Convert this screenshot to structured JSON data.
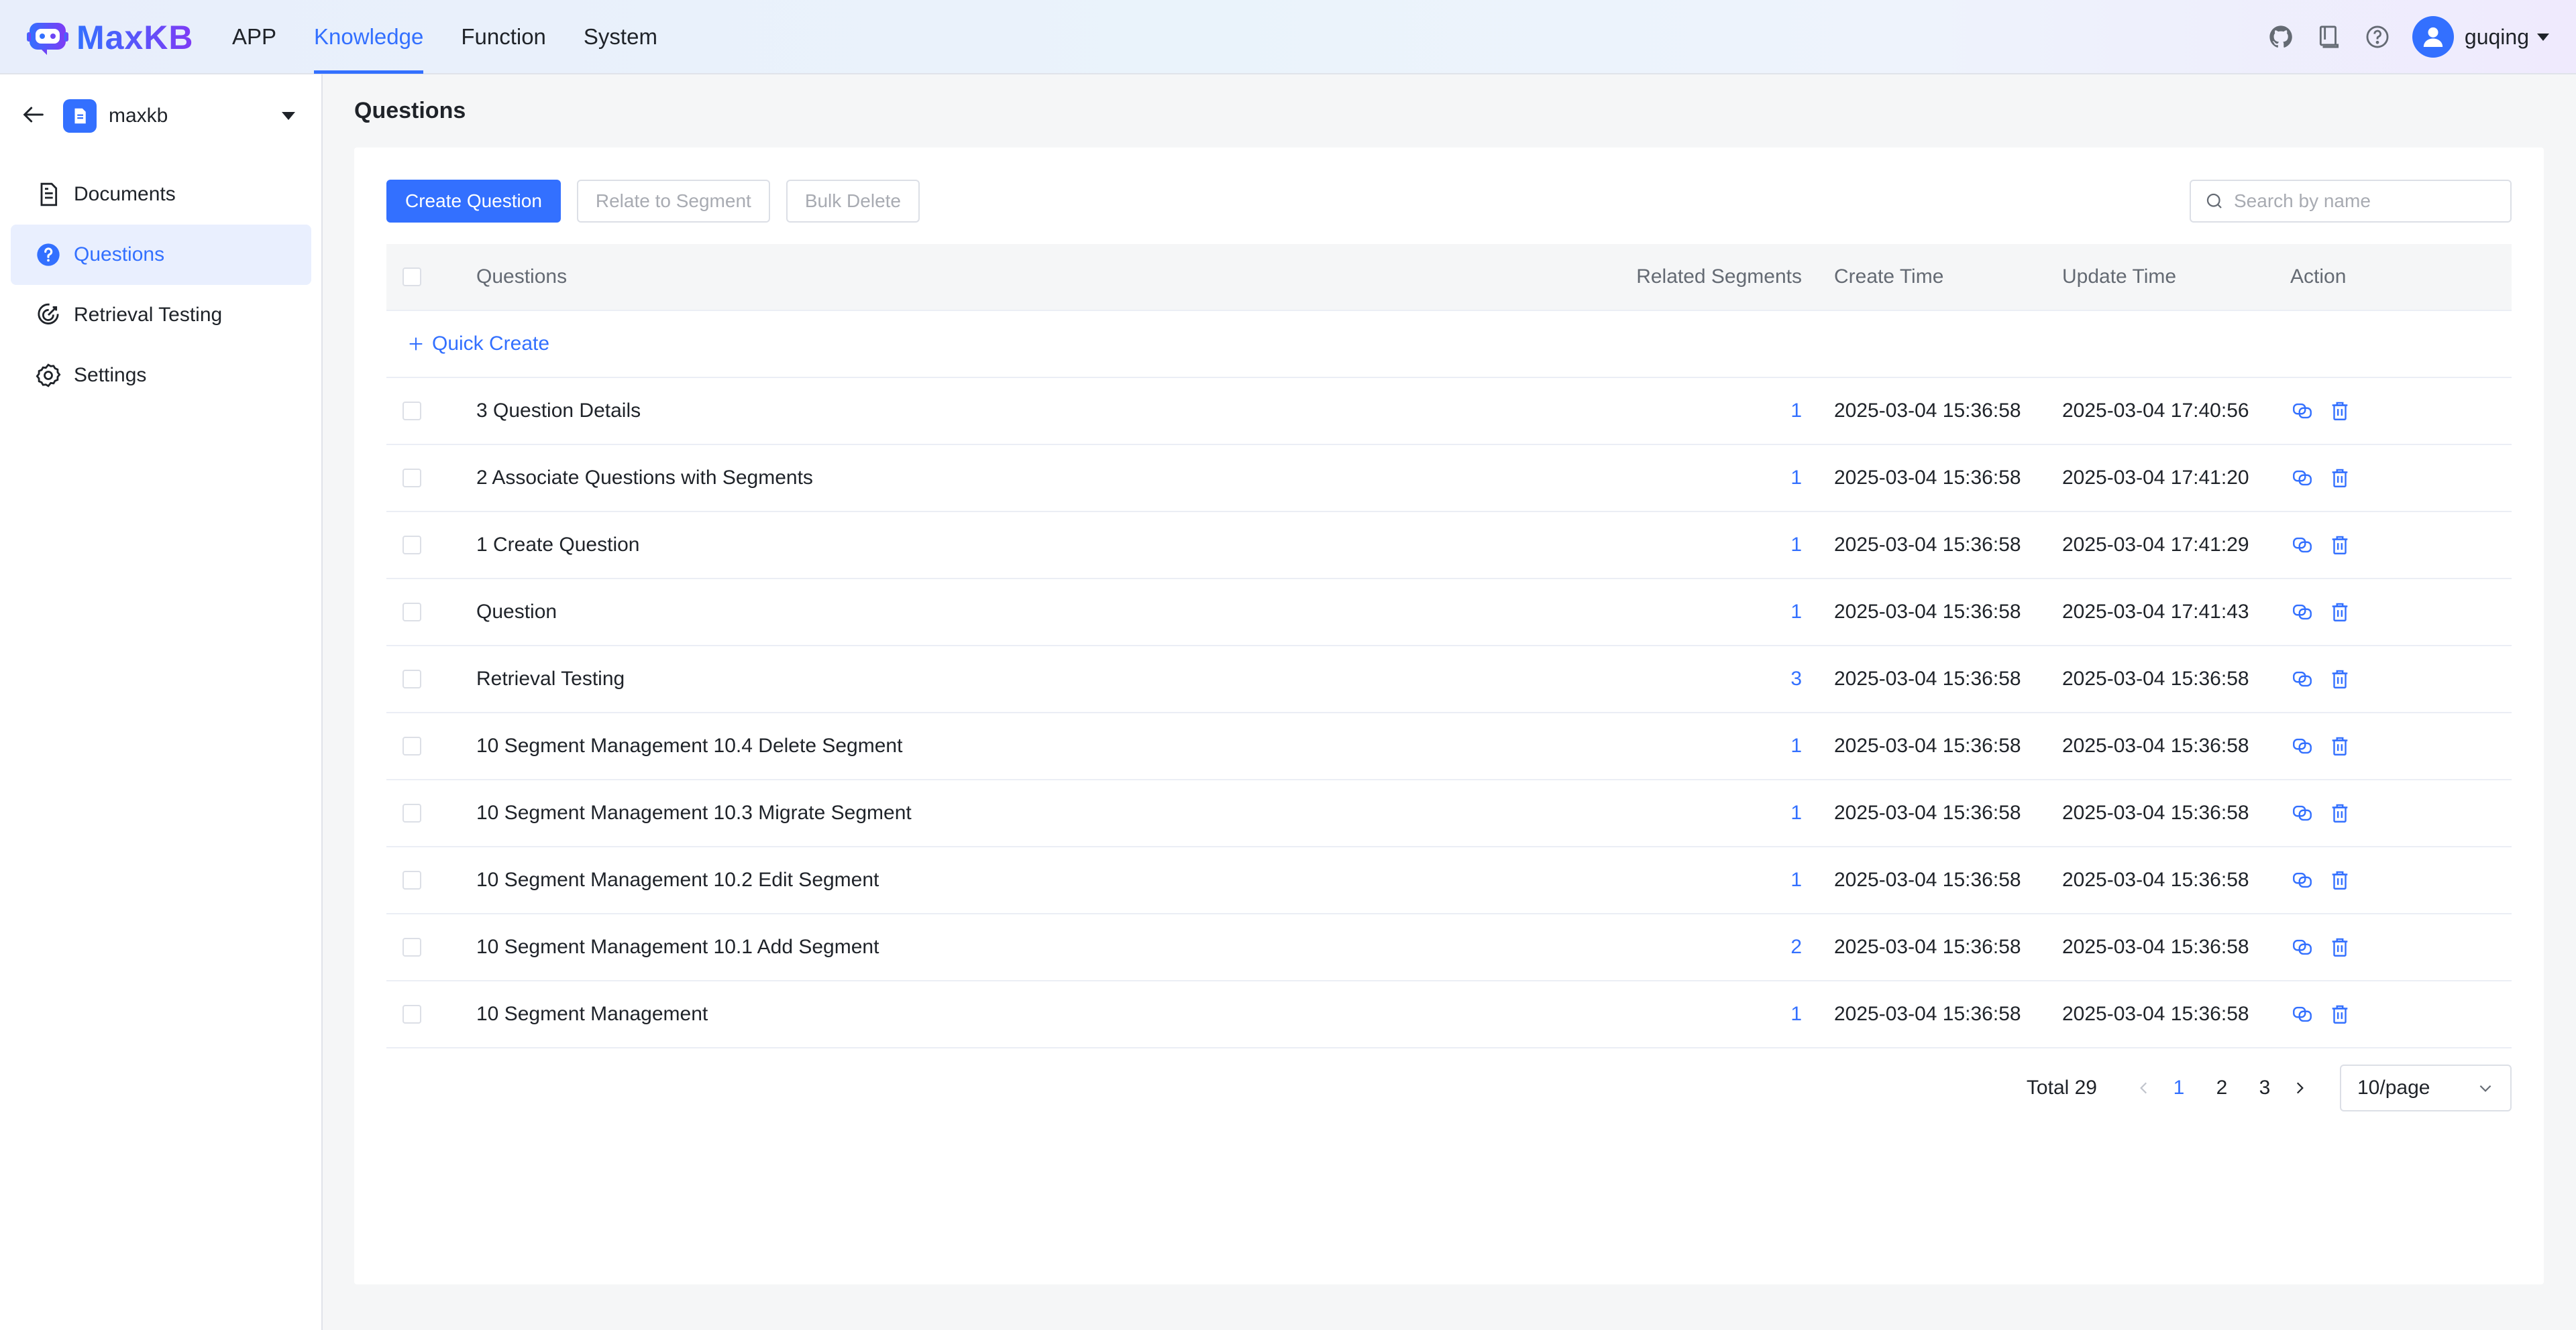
{
  "header": {
    "brand": "MaxKB",
    "nav": [
      "APP",
      "Knowledge",
      "Function",
      "System"
    ],
    "active_nav": "Knowledge",
    "icons": [
      "github-icon",
      "book-icon",
      "help-icon"
    ],
    "username": "guqing"
  },
  "sidebar": {
    "knowledge_base": "maxkb",
    "items": [
      {
        "label": "Documents",
        "icon": "document-icon"
      },
      {
        "label": "Questions",
        "icon": "question-icon",
        "active": true
      },
      {
        "label": "Retrieval Testing",
        "icon": "target-icon"
      },
      {
        "label": "Settings",
        "icon": "gear-icon"
      }
    ]
  },
  "page": {
    "title": "Questions"
  },
  "toolbar": {
    "create_label": "Create Question",
    "relate_label": "Relate to Segment",
    "bulk_delete_label": "Bulk Delete",
    "search_placeholder": "Search by name"
  },
  "table": {
    "columns": [
      "Questions",
      "Related Segments",
      "Create Time",
      "Update Time",
      "Action"
    ],
    "quick_create": "Quick Create",
    "rows": [
      {
        "question": "3 Question Details",
        "segments": "1",
        "create_time": "2025-03-04 15:36:58",
        "update_time": "2025-03-04 17:40:56"
      },
      {
        "question": "2 Associate Questions with Segments",
        "segments": "1",
        "create_time": "2025-03-04 15:36:58",
        "update_time": "2025-03-04 17:41:20"
      },
      {
        "question": "1 Create Question",
        "segments": "1",
        "create_time": "2025-03-04 15:36:58",
        "update_time": "2025-03-04 17:41:29"
      },
      {
        "question": "Question",
        "segments": "1",
        "create_time": "2025-03-04 15:36:58",
        "update_time": "2025-03-04 17:41:43"
      },
      {
        "question": "Retrieval Testing",
        "segments": "3",
        "create_time": "2025-03-04 15:36:58",
        "update_time": "2025-03-04 15:36:58"
      },
      {
        "question": "10 Segment Management 10.4 Delete Segment",
        "segments": "1",
        "create_time": "2025-03-04 15:36:58",
        "update_time": "2025-03-04 15:36:58"
      },
      {
        "question": "10 Segment Management 10.3 Migrate Segment",
        "segments": "1",
        "create_time": "2025-03-04 15:36:58",
        "update_time": "2025-03-04 15:36:58"
      },
      {
        "question": "10 Segment Management 10.2 Edit Segment",
        "segments": "1",
        "create_time": "2025-03-04 15:36:58",
        "update_time": "2025-03-04 15:36:58"
      },
      {
        "question": "10 Segment Management 10.1 Add Segment",
        "segments": "2",
        "create_time": "2025-03-04 15:36:58",
        "update_time": "2025-03-04 15:36:58"
      },
      {
        "question": "10 Segment Management",
        "segments": "1",
        "create_time": "2025-03-04 15:36:58",
        "update_time": "2025-03-04 15:36:58"
      }
    ]
  },
  "pagination": {
    "total": "Total 29",
    "pages": [
      "1",
      "2",
      "3"
    ],
    "current": "1",
    "page_size": "10/page"
  },
  "colors": {
    "accent": "#3370ff",
    "active_bg": "#e9effe",
    "page_bg": "#f5f6f7"
  }
}
